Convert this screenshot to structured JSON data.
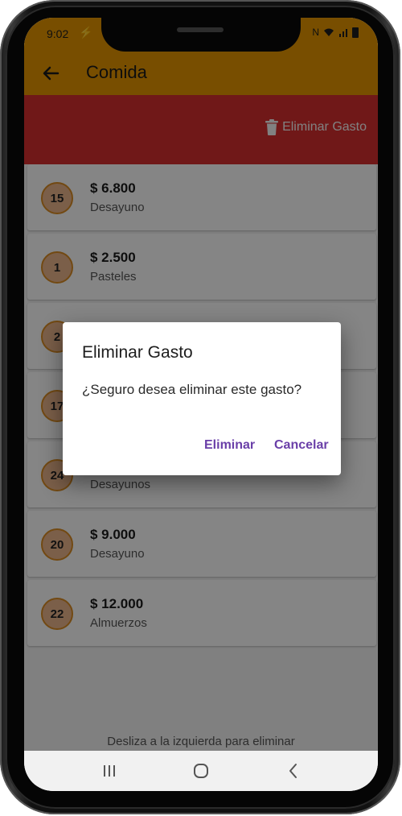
{
  "status_bar": {
    "time": "9:02",
    "right_text": "N"
  },
  "app_bar": {
    "title": "Comida"
  },
  "swipe_action": {
    "label": "Eliminar Gasto"
  },
  "expenses": [
    {
      "count": "15",
      "amount": "$ 6.800",
      "category": "Desayuno"
    },
    {
      "count": "1",
      "amount": "$ 2.500",
      "category": "Pasteles"
    },
    {
      "count": "2",
      "amount": "",
      "category": ""
    },
    {
      "count": "17",
      "amount": "",
      "category": ""
    },
    {
      "count": "24",
      "amount": "",
      "category": "Desayunos"
    },
    {
      "count": "20",
      "amount": "$ 9.000",
      "category": "Desayuno"
    },
    {
      "count": "22",
      "amount": "$ 12.000",
      "category": "Almuerzos"
    }
  ],
  "hint": "Desliza a la izquierda para eliminar",
  "dialog": {
    "title": "Eliminar Gasto",
    "message": "¿Seguro desea eliminar este gasto?",
    "confirm_label": "Eliminar",
    "cancel_label": "Cancelar"
  },
  "colors": {
    "app_bar": "#e39300",
    "delete_bg": "#d42f2f",
    "badge_fill": "#e9b38a",
    "badge_border": "#d78a23",
    "dialog_button": "#6a3fa8"
  }
}
